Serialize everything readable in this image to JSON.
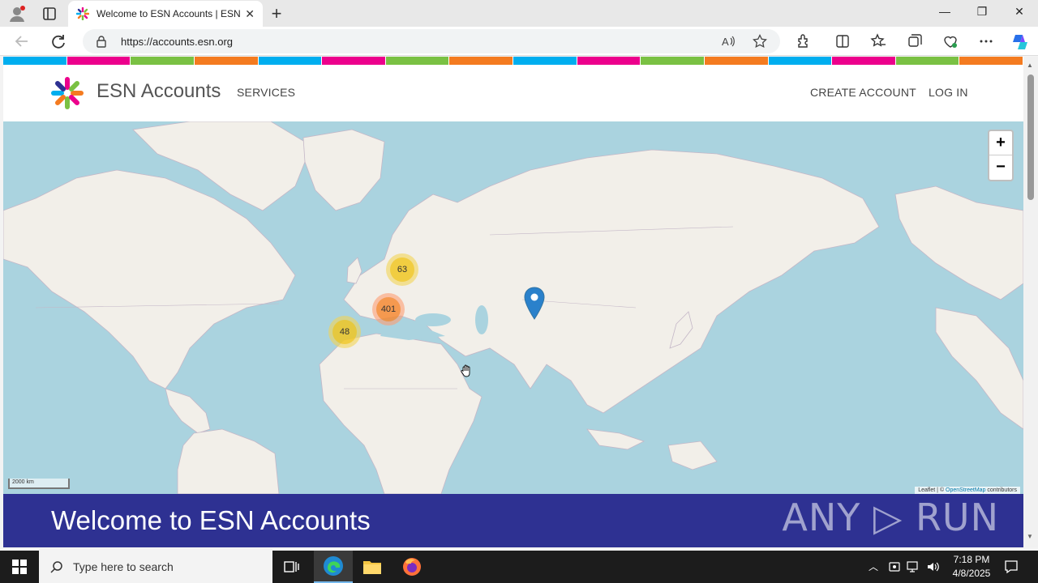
{
  "browser": {
    "tab_title": "Welcome to ESN Accounts | ESN",
    "url": "https://accounts.esn.org",
    "new_tab": "+",
    "tab_close": "✕"
  },
  "site": {
    "stripe_colors": [
      "#00aeef",
      "#ec008c",
      "#7ac143",
      "#f47b20"
    ],
    "brand": "ESN Accounts",
    "nav": {
      "services": "SERVICES",
      "create_account": "CREATE ACCOUNT",
      "log_in": "LOG IN"
    }
  },
  "map": {
    "zoom_in": "+",
    "zoom_out": "−",
    "clusters": [
      {
        "count": "63",
        "level": "medium"
      },
      {
        "count": "401",
        "level": "large"
      },
      {
        "count": "48",
        "level": "medium"
      }
    ],
    "scale": "2000 km",
    "attribution_leaflet": "Leaflet",
    "attribution_sep": " | © ",
    "attribution_osm": "OpenStreetMap",
    "attribution_tail": " contributors"
  },
  "banner": {
    "welcome": "Welcome to ESN Accounts",
    "watermark": "ANY ▷ RUN"
  },
  "taskbar": {
    "search_placeholder": "Type here to search",
    "time": "7:18 PM",
    "date": "4/8/2025"
  },
  "colors": {
    "banner_bg": "#2e3192",
    "ocean": "#aad3df",
    "land": "#f2efe9",
    "cluster_medium": "#f1d357",
    "cluster_large": "#fd9c73",
    "marker": "#2a81cb"
  }
}
